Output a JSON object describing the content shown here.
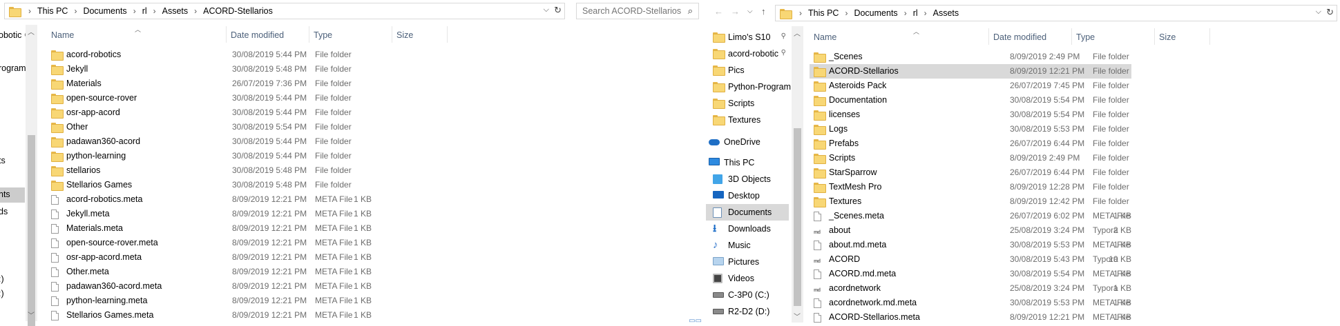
{
  "left": {
    "breadcrumb": [
      "This PC",
      "Documents",
      "rl",
      "Assets",
      "ACORD-Stellarios"
    ],
    "search_placeholder": "Search ACORD-Stellarios",
    "columns": {
      "name": "Name",
      "date": "Date modified",
      "type": "Type",
      "size": "Size"
    },
    "nav_fragments": [
      "obotic",
      "rogram",
      "ts",
      "nts",
      "ds",
      ":)",
      ":)"
    ],
    "rows": [
      {
        "name": "acord-robotics",
        "date": "30/08/2019 5:44 PM",
        "type": "File folder",
        "size": "",
        "icon": "folder-icon"
      },
      {
        "name": "Jekyll",
        "date": "30/08/2019 5:48 PM",
        "type": "File folder",
        "size": "",
        "icon": "folder-icon"
      },
      {
        "name": "Materials",
        "date": "26/07/2019 7:36 PM",
        "type": "File folder",
        "size": "",
        "icon": "folder-icon"
      },
      {
        "name": "open-source-rover",
        "date": "30/08/2019 5:44 PM",
        "type": "File folder",
        "size": "",
        "icon": "folder-icon"
      },
      {
        "name": "osr-app-acord",
        "date": "30/08/2019 5:44 PM",
        "type": "File folder",
        "size": "",
        "icon": "folder-icon"
      },
      {
        "name": "Other",
        "date": "30/08/2019 5:54 PM",
        "type": "File folder",
        "size": "",
        "icon": "folder-icon"
      },
      {
        "name": "padawan360-acord",
        "date": "30/08/2019 5:44 PM",
        "type": "File folder",
        "size": "",
        "icon": "folder-icon"
      },
      {
        "name": "python-learning",
        "date": "30/08/2019 5:44 PM",
        "type": "File folder",
        "size": "",
        "icon": "folder-icon"
      },
      {
        "name": "stellarios",
        "date": "30/08/2019 5:48 PM",
        "type": "File folder",
        "size": "",
        "icon": "folder-icon"
      },
      {
        "name": "Stellarios Games",
        "date": "30/08/2019 5:48 PM",
        "type": "File folder",
        "size": "",
        "icon": "folder-icon"
      },
      {
        "name": "acord-robotics.meta",
        "date": "8/09/2019 12:21 PM",
        "type": "META File",
        "size": "1 KB",
        "icon": "file-icon"
      },
      {
        "name": "Jekyll.meta",
        "date": "8/09/2019 12:21 PM",
        "type": "META File",
        "size": "1 KB",
        "icon": "file-icon"
      },
      {
        "name": "Materials.meta",
        "date": "8/09/2019 12:21 PM",
        "type": "META File",
        "size": "1 KB",
        "icon": "file-icon"
      },
      {
        "name": "open-source-rover.meta",
        "date": "8/09/2019 12:21 PM",
        "type": "META File",
        "size": "1 KB",
        "icon": "file-icon"
      },
      {
        "name": "osr-app-acord.meta",
        "date": "8/09/2019 12:21 PM",
        "type": "META File",
        "size": "1 KB",
        "icon": "file-icon"
      },
      {
        "name": "Other.meta",
        "date": "8/09/2019 12:21 PM",
        "type": "META File",
        "size": "1 KB",
        "icon": "file-icon"
      },
      {
        "name": "padawan360-acord.meta",
        "date": "8/09/2019 12:21 PM",
        "type": "META File",
        "size": "1 KB",
        "icon": "file-icon"
      },
      {
        "name": "python-learning.meta",
        "date": "8/09/2019 12:21 PM",
        "type": "META File",
        "size": "1 KB",
        "icon": "file-icon"
      },
      {
        "name": "Stellarios Games.meta",
        "date": "8/09/2019 12:21 PM",
        "type": "META File",
        "size": "1 KB",
        "icon": "file-icon"
      }
    ]
  },
  "right": {
    "breadcrumb": [
      "This PC",
      "Documents",
      "rl",
      "Assets"
    ],
    "columns": {
      "name": "Name",
      "date": "Date modified",
      "type": "Type",
      "size": "Size"
    },
    "nav": [
      {
        "label": "Limo's S10",
        "icon": "folder-icon",
        "pinned": true
      },
      {
        "label": "acord-robotic",
        "icon": "folder-icon",
        "pinned": true
      },
      {
        "label": "Pics",
        "icon": "folder-icon",
        "pinned": false
      },
      {
        "label": "Python-Program",
        "icon": "folder-icon",
        "pinned": false
      },
      {
        "label": "Scripts",
        "icon": "folder-icon",
        "pinned": false
      },
      {
        "label": "Textures",
        "icon": "folder-icon",
        "pinned": false
      },
      {
        "label": "OneDrive",
        "icon": "cloud-icon",
        "pinned": false
      },
      {
        "label": "This PC",
        "icon": "computer-icon",
        "pinned": false
      },
      {
        "label": "3D Objects",
        "icon": "cube-icon",
        "pinned": false
      },
      {
        "label": "Desktop",
        "icon": "desktop-icon",
        "pinned": false
      },
      {
        "label": "Documents",
        "icon": "documents-icon",
        "pinned": false,
        "selected": true
      },
      {
        "label": "Downloads",
        "icon": "download-icon",
        "pinned": false
      },
      {
        "label": "Music",
        "icon": "music-icon",
        "pinned": false
      },
      {
        "label": "Pictures",
        "icon": "pictures-icon",
        "pinned": false
      },
      {
        "label": "Videos",
        "icon": "videos-icon",
        "pinned": false
      },
      {
        "label": "C-3P0 (C:)",
        "icon": "drive-icon",
        "pinned": false
      },
      {
        "label": "R2-D2 (D:)",
        "icon": "drive-icon",
        "pinned": false
      }
    ],
    "rows": [
      {
        "name": "_Scenes",
        "date": "8/09/2019 2:49 PM",
        "type": "File folder",
        "size": "",
        "icon": "folder-icon"
      },
      {
        "name": "ACORD-Stellarios",
        "date": "8/09/2019 12:21 PM",
        "type": "File folder",
        "size": "",
        "icon": "folder-icon",
        "selected": true
      },
      {
        "name": "Asteroids Pack",
        "date": "26/07/2019 7:45 PM",
        "type": "File folder",
        "size": "",
        "icon": "folder-icon"
      },
      {
        "name": "Documentation",
        "date": "30/08/2019 5:54 PM",
        "type": "File folder",
        "size": "",
        "icon": "folder-icon"
      },
      {
        "name": "licenses",
        "date": "30/08/2019 5:54 PM",
        "type": "File folder",
        "size": "",
        "icon": "folder-icon"
      },
      {
        "name": "Logs",
        "date": "30/08/2019 5:53 PM",
        "type": "File folder",
        "size": "",
        "icon": "folder-icon"
      },
      {
        "name": "Prefabs",
        "date": "26/07/2019 6:44 PM",
        "type": "File folder",
        "size": "",
        "icon": "folder-icon"
      },
      {
        "name": "Scripts",
        "date": "8/09/2019 2:49 PM",
        "type": "File folder",
        "size": "",
        "icon": "folder-icon"
      },
      {
        "name": "StarSparrow",
        "date": "26/07/2019 6:44 PM",
        "type": "File folder",
        "size": "",
        "icon": "folder-icon"
      },
      {
        "name": "TextMesh Pro",
        "date": "8/09/2019 12:28 PM",
        "type": "File folder",
        "size": "",
        "icon": "folder-icon"
      },
      {
        "name": "Textures",
        "date": "8/09/2019 12:42 PM",
        "type": "File folder",
        "size": "",
        "icon": "folder-icon"
      },
      {
        "name": "_Scenes.meta",
        "date": "26/07/2019 6:02 PM",
        "type": "META File",
        "size": "1 KB",
        "icon": "file-icon"
      },
      {
        "name": "about",
        "date": "25/08/2019 3:24 PM",
        "type": "Typora",
        "size": "2 KB",
        "icon": "typora-icon"
      },
      {
        "name": "about.md.meta",
        "date": "30/08/2019 5:53 PM",
        "type": "META File",
        "size": "1 KB",
        "icon": "file-icon"
      },
      {
        "name": "ACORD",
        "date": "30/08/2019 5:43 PM",
        "type": "Typora",
        "size": "10 KB",
        "icon": "typora-icon"
      },
      {
        "name": "ACORD.md.meta",
        "date": "30/08/2019 5:54 PM",
        "type": "META File",
        "size": "1 KB",
        "icon": "file-icon"
      },
      {
        "name": "acordnetwork",
        "date": "25/08/2019 3:24 PM",
        "type": "Typora",
        "size": "1 KB",
        "icon": "typora-icon"
      },
      {
        "name": "acordnetwork.md.meta",
        "date": "30/08/2019 5:53 PM",
        "type": "META File",
        "size": "1 KB",
        "icon": "file-icon"
      },
      {
        "name": "ACORD-Stellarios.meta",
        "date": "8/09/2019 12:21 PM",
        "type": "META File",
        "size": "1 KB",
        "icon": "file-icon"
      }
    ]
  }
}
